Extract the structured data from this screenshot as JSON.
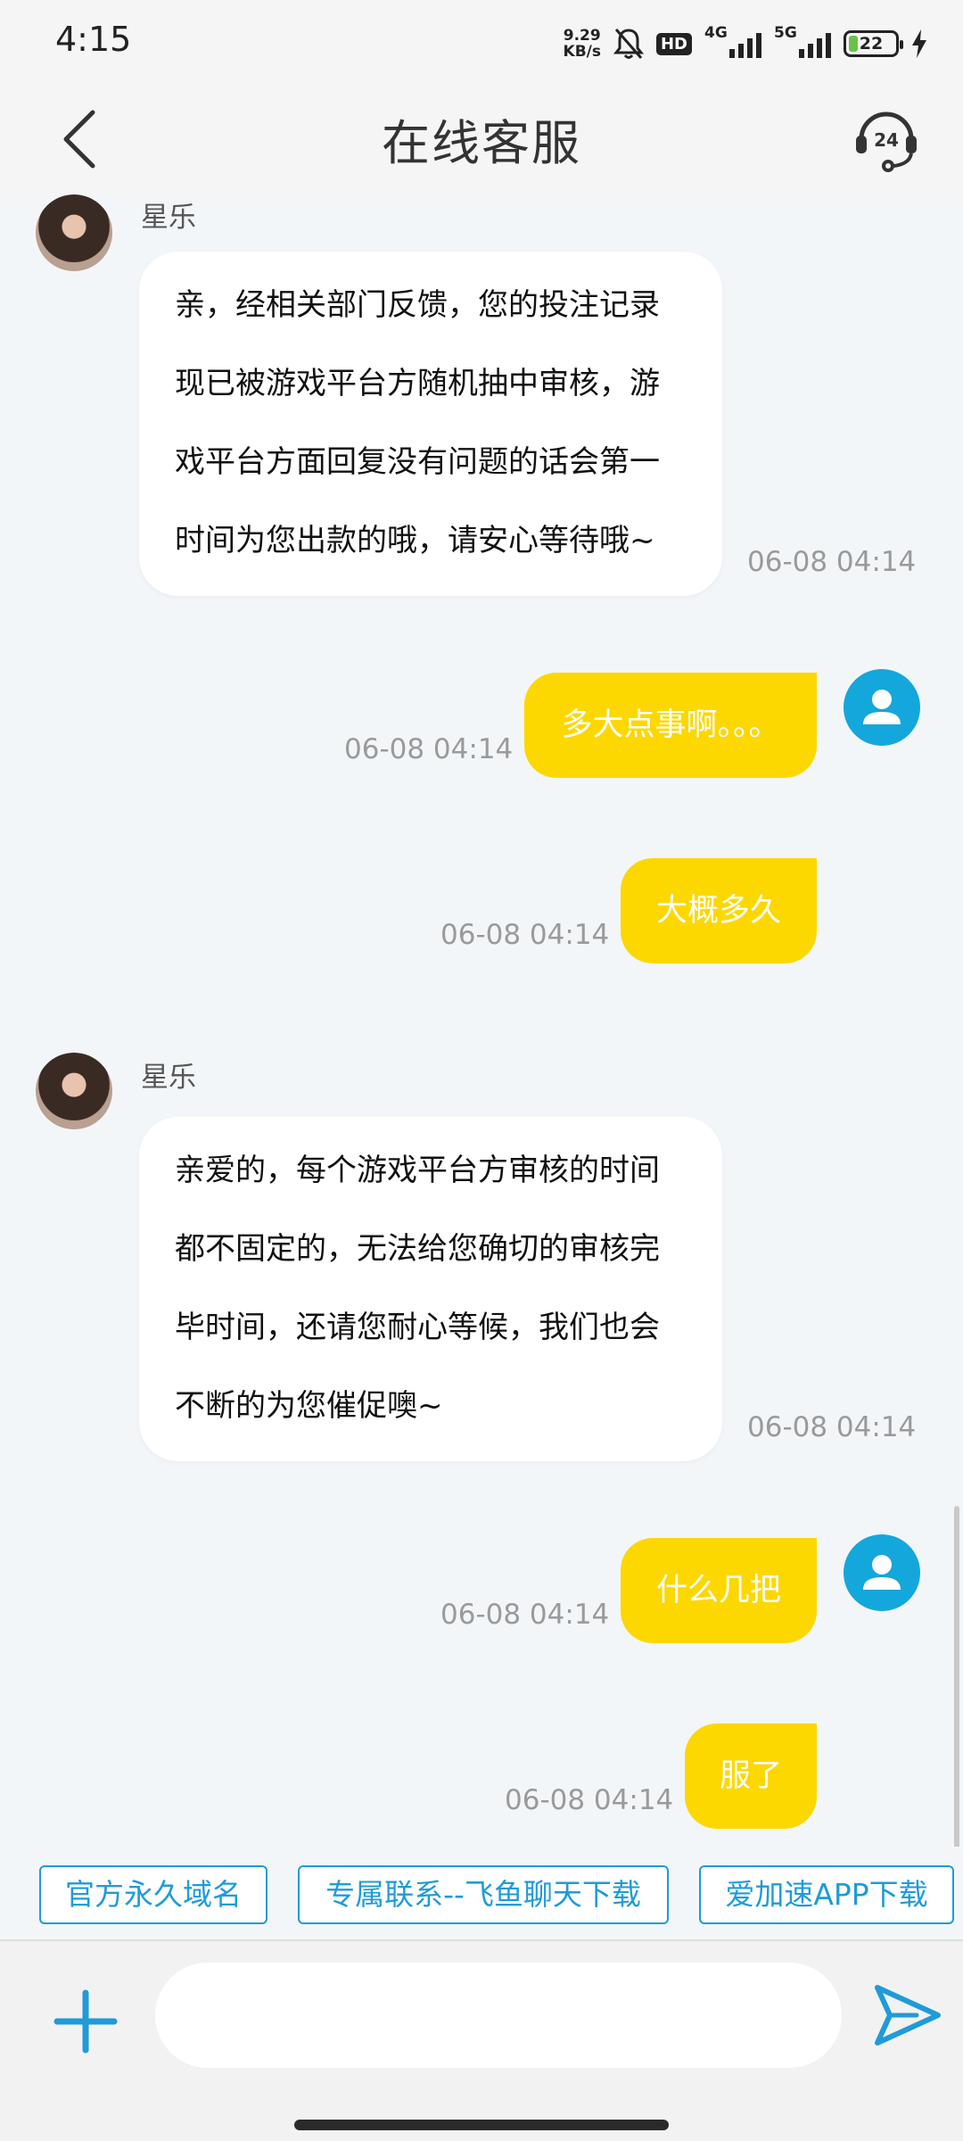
{
  "status_bar": {
    "time": "4:15",
    "net_speed_value": "9.29",
    "net_speed_unit": "KB/s",
    "hd_badge": "HD",
    "signal_1": "4G",
    "signal_2": "5G",
    "battery_level": "22"
  },
  "header": {
    "title": "在线客服",
    "service_icon_text": "24"
  },
  "messages": [
    {
      "sender": "星乐",
      "lines": [
        "亲，经相关部门反馈，您的投注记录",
        "现已被游戏平台方随机抽中审核，游",
        "戏平台方面回复没有问题的话会第一",
        "时间为您出款的哦，请安心等待哦~"
      ],
      "time": "06-08 04:14"
    },
    {
      "text": "多大点事啊。。。",
      "time": "06-08 04:14"
    },
    {
      "text": "大概多久",
      "time": "06-08 04:14"
    },
    {
      "sender": "星乐",
      "lines": [
        "亲爱的，每个游戏平台方审核的时间",
        "都不固定的，无法给您确切的审核完",
        "毕时间，还请您耐心等候，我们也会",
        "不断的为您催促噢~"
      ],
      "time": "06-08 04:14"
    },
    {
      "text": "什么几把",
      "time": "06-08 04:14"
    },
    {
      "text": "服了",
      "time": "06-08 04:14"
    }
  ],
  "quick_links": [
    "官方永久域名",
    "专属联系--飞鱼聊天下载",
    "爱加速APP下载"
  ],
  "input": {
    "value": "",
    "placeholder": ""
  },
  "colors": {
    "accent": "#1f9bd8",
    "user_bubble": "#fdd700",
    "user_avatar": "#14a7dc",
    "background": "#f3f6f9"
  },
  "icons": [
    "back-arrow-icon",
    "headset-24h-icon",
    "user-avatar-icon",
    "plus-icon",
    "send-icon",
    "mute-bell-icon"
  ]
}
